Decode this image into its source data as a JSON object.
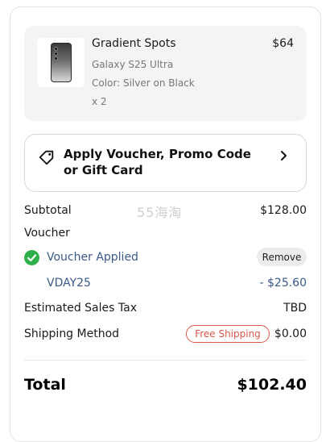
{
  "product": {
    "name": "Gradient Spots",
    "price": "$64",
    "model": "Galaxy S25 Ultra",
    "color": "Color: Silver on Black",
    "quantity": "x 2",
    "thumb_icon": "phone-case-image"
  },
  "voucher_button": {
    "label": "Apply Voucher, Promo Code or Gift Card",
    "icon": "tag-icon",
    "chevron": "chevron-right-icon"
  },
  "summary": {
    "subtotal_label": "Subtotal",
    "subtotal_value": "$128.00",
    "voucher_label": "Voucher",
    "voucher_applied": "Voucher Applied",
    "remove_label": "Remove",
    "voucher_code": "VDAY25",
    "discount": "- $25.60",
    "tax_label": "Estimated Sales Tax",
    "tax_value": "TBD",
    "shipping_label": "Shipping Method",
    "shipping_badge": "Free Shipping",
    "shipping_value": "$0.00",
    "total_label": "Total",
    "total_value": "$102.40"
  },
  "watermark": "55海淘",
  "colors": {
    "success": "#2fb04a",
    "link": "#3a5a88",
    "badge": "#d9574a"
  }
}
